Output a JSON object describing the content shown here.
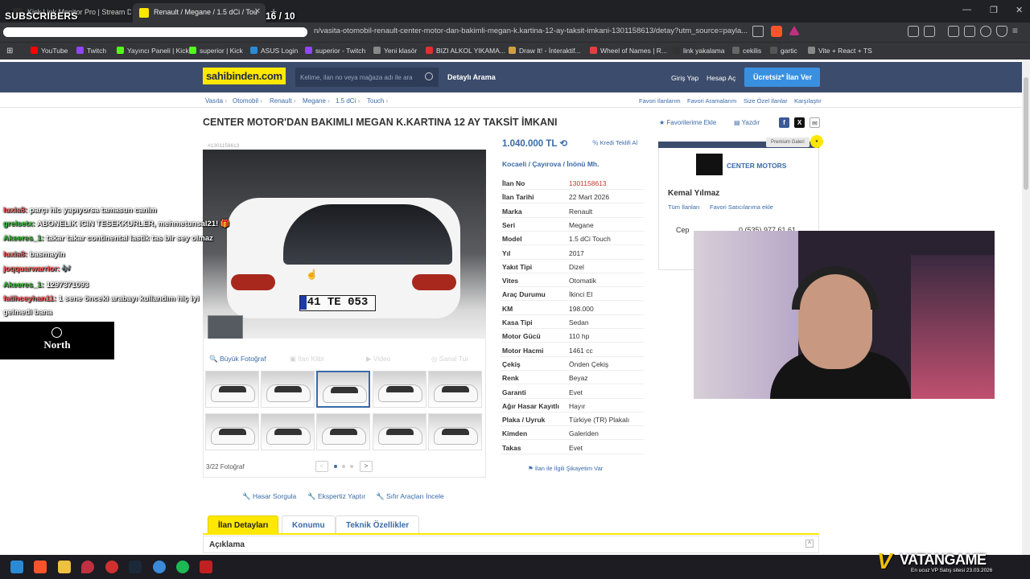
{
  "browser": {
    "tabs": [
      {
        "label": "Kick Link Monitor Pro | Stream Deck",
        "favicon_color": "#2b2b2b"
      },
      {
        "label": "Renault / Megane / 1.5 dCi / Tou",
        "favicon_color": "#ffe800"
      }
    ],
    "url": "n/vasita-otomobil-renault-center-motor-dan-bakimli-megan-k.kartina-12-ay-taksit-imkani-1301158613/detay?utm_source=payla..."
  },
  "bookmarks": [
    {
      "label": "YouTube",
      "color": "#ff0000"
    },
    {
      "label": "Twitch",
      "color": "#9146ff"
    },
    {
      "label": "Yayıncı Paneli | Kick",
      "color": "#53fc18"
    },
    {
      "label": "superior | Kick",
      "color": "#53fc18"
    },
    {
      "label": "ASUS Login",
      "color": "#2a8ad4"
    },
    {
      "label": "superior - Twitch",
      "color": "#9146ff"
    },
    {
      "label": "Yeni klasör",
      "color": "#888888"
    },
    {
      "label": "BIZI ALKOL YIKAMA...",
      "color": "#e03030"
    },
    {
      "label": "Draw It! - İnteraktif...",
      "color": "#d0a040"
    },
    {
      "label": "Wheel of Names | R...",
      "color": "#e04040"
    },
    {
      "label": "link yakalama",
      "color": "#333333"
    },
    {
      "label": "cekilis",
      "color": "#666666"
    },
    {
      "label": "gartic",
      "color": "#555555"
    },
    {
      "label": "Vite + React + TS",
      "color": "#888888"
    }
  ],
  "header": {
    "logo": "sahibinden.com",
    "search_placeholder": "Kelime, ilan no veya mağaza adı ile ara",
    "detailed_search": "Detaylı Arama",
    "login": "Giriş Yap",
    "register": "Hesap Aç",
    "post_ad": "Ücretsiz* İlan Ver"
  },
  "breadcrumb": [
    "Vasıta",
    "Otomobil",
    "Renault",
    "Megane",
    "1.5 dCi",
    "Touch"
  ],
  "top_links": [
    "Favori İlanlarım",
    "Favori Aramalarım",
    "Size Özel İlanlar",
    "Karşılaştır"
  ],
  "listing": {
    "title": "CENTER MOTOR'DAN BAKIMLI MEGAN K.KARTINA 12 AY TAKSİT İMKANI",
    "add_favorite": "Favorilerime Ekle",
    "print": "Yazdır",
    "listing_code": "#1301158613",
    "price": "1.040.000 TL",
    "credit_offer": "Kredi Teklifi Al",
    "location": [
      "Kocaeli",
      "Çayırova",
      "İnönü Mh."
    ],
    "plate_text": "41 TE 053",
    "details": [
      {
        "key": "İlan No",
        "value": "1301158613",
        "highlight": true
      },
      {
        "key": "İlan Tarihi",
        "value": "22 Mart 2026"
      },
      {
        "key": "Marka",
        "value": "Renault"
      },
      {
        "key": "Seri",
        "value": "Megane"
      },
      {
        "key": "Model",
        "value": "1.5 dCi Touch"
      },
      {
        "key": "Yıl",
        "value": "2017"
      },
      {
        "key": "Yakıt Tipi",
        "value": "Dizel"
      },
      {
        "key": "Vites",
        "value": "Otomatik"
      },
      {
        "key": "Araç Durumu",
        "value": "İkinci El"
      },
      {
        "key": "KM",
        "value": "198.000"
      },
      {
        "key": "Kasa Tipi",
        "value": "Sedan"
      },
      {
        "key": "Motor Gücü",
        "value": "110 hp"
      },
      {
        "key": "Motor Hacmi",
        "value": "1461 cc"
      },
      {
        "key": "Çekiş",
        "value": "Önden Çekiş"
      },
      {
        "key": "Renk",
        "value": "Beyaz"
      },
      {
        "key": "Garanti",
        "value": "Evet"
      },
      {
        "key": "Ağır Hasar Kayıtlı",
        "value": "Hayır"
      },
      {
        "key": "Plaka / Uyruk",
        "value": "Türkiye (TR) Plakalı"
      },
      {
        "key": "Kimden",
        "value": "Galeriden"
      },
      {
        "key": "Takas",
        "value": "Evet"
      }
    ],
    "complaint": "İlan ile İlgili Şikayetim Var"
  },
  "photo_tools": {
    "big_photo": "Büyük Fotoğraf",
    "video_clip": "İlan Klibi",
    "video": "Video",
    "virtual_tour": "Sanal Tur",
    "photo_count": "3/22 Fotoğraf",
    "prev": "<",
    "next": ">"
  },
  "action_links": [
    "Hasar Sorgula",
    "Ekspertiz Yaptır",
    "Sıfır Araçları İncele"
  ],
  "detail_tabs": [
    "İlan Detayları",
    "Konumu",
    "Teknik Özellikler"
  ],
  "description_heading": "Açıklama",
  "seller": {
    "premium_label": "Premium Galeri",
    "store_name": "CENTER MOTORS",
    "person": "Kemal Yılmaz",
    "all_listings": "Tüm İlanları",
    "add_fav_seller": "Favori Satıcılarıma ekle",
    "phone_label": "Cep",
    "phone": "0 (535) 977 61 61"
  },
  "overlay": {
    "subscribers_label": "SUBSCRIBERS",
    "counter": "16  / 10",
    "progress_fraction": 1.0,
    "chat": [
      {
        "user": "luxia8:",
        "text": " parçı hic yapıyorsa tamasun canim",
        "ucls": "u2"
      },
      {
        "user": "grelsetx:",
        "text": " ABONELIK ICIN TESEKKURLER, mehmetunsal21! 🎁",
        "ucls": "u"
      },
      {
        "user": "Akeeres_1:",
        "text": " takar takar continental lastik tas bir sey olmaz",
        "ucls": "u"
      },
      {
        "user": "luxia8:",
        "text": " basmayin",
        "ucls": "u2"
      },
      {
        "user": "joqquarwarrior:",
        "text": " 🎶",
        "ucls": "u2"
      },
      {
        "user": "Akeeres_1:",
        "text": " 1297371093",
        "ucls": "u"
      },
      {
        "user": "fatihceyhan11:",
        "text": " 1 sene önceki arabayı kullandım hiç iyi",
        "ucls": "u2"
      },
      {
        "user": "",
        "text": "gelmedi bana",
        "ucls": "u"
      }
    ],
    "sponsor": "North"
  },
  "watermark": {
    "brand": "VATANGAME",
    "tagline": "En ucuz VP Satış sitesi 23.03.2026"
  }
}
